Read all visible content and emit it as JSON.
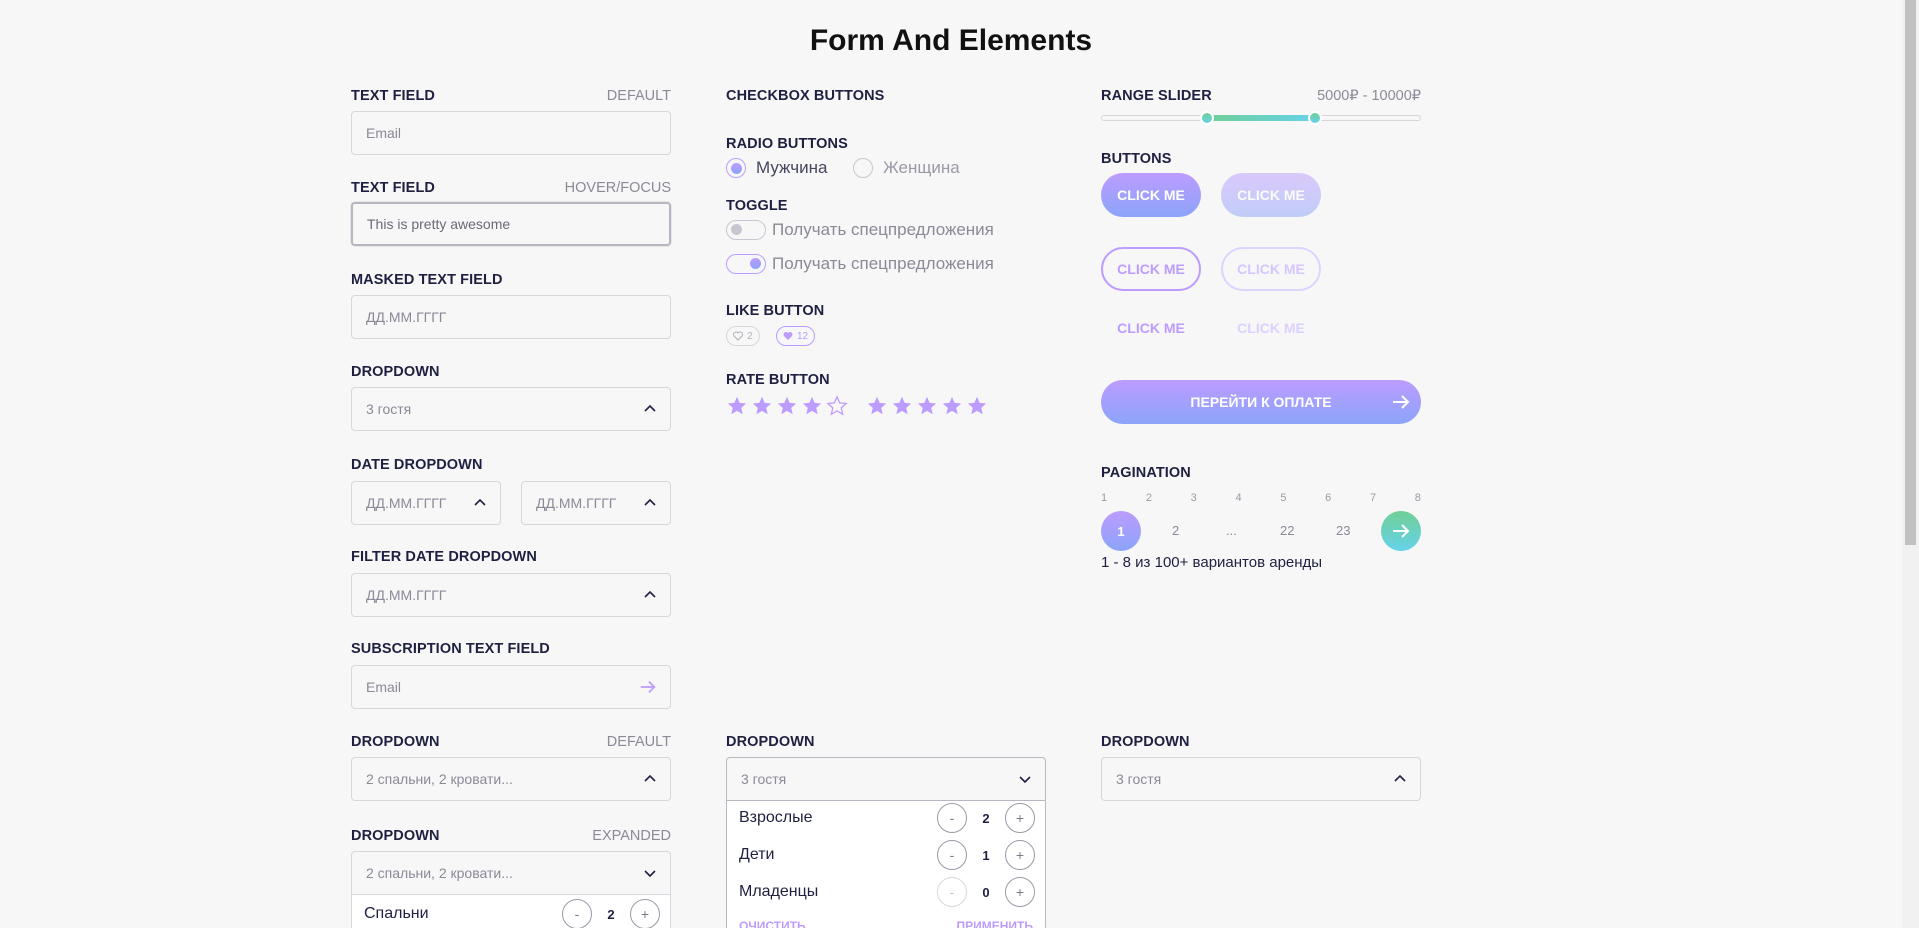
{
  "page_title": "Form And Elements",
  "col1": {
    "text_field": {
      "label": "TEXT FIELD",
      "state": "DEFAULT",
      "placeholder": "Email"
    },
    "text_field_focus": {
      "label": "TEXT FIELD",
      "state": "HOVER/FOCUS",
      "value": "This is pretty awesome"
    },
    "masked": {
      "label": "MASKED TEXT FIELD",
      "placeholder": "ДД.ММ.ГГГГ"
    },
    "dropdown": {
      "label": "DROPDOWN",
      "value": "3 гостя"
    },
    "date_dropdown": {
      "label": "DATE DROPDOWN",
      "from": "ДД.ММ.ГГГГ",
      "to": "ДД.ММ.ГГГГ"
    },
    "filter_date": {
      "label": "FILTER DATE DROPDOWN",
      "placeholder": "ДД.ММ.ГГГГ"
    },
    "subscription": {
      "label": "SUBSCRIPTION TEXT FIELD",
      "placeholder": "Email"
    },
    "dropdown_default": {
      "label": "DROPDOWN",
      "state": "DEFAULT",
      "value": "2  спальни, 2  кровати..."
    },
    "dropdown_expanded": {
      "label": "DROPDOWN",
      "state": "EXPANDED",
      "value": "2  спальни, 2  кровати...",
      "rows": [
        {
          "name": "Спальни",
          "count": "2"
        }
      ]
    }
  },
  "col2": {
    "checkbox_label": "CHECKBOX BUTTONS",
    "radio": {
      "label": "RADIO BUTTONS",
      "options": [
        "Мужчина",
        "Женщина"
      ],
      "selected": 0
    },
    "toggle": {
      "label": "TOGGLE",
      "items": [
        "Получать спецпредложения",
        "Получать спецпредложения"
      ]
    },
    "like": {
      "label": "LIKE BUTTON",
      "off_count": "2",
      "on_count": "12"
    },
    "rate": {
      "label": "RATE BUTTON",
      "first": 4,
      "second": 5
    },
    "guests_dropdown": {
      "label": "DROPDOWN",
      "value": "3 гостя",
      "rows": [
        {
          "name": "Взрослые",
          "count": "2"
        },
        {
          "name": "Дети",
          "count": "1"
        },
        {
          "name": "Младенцы",
          "count": "0"
        }
      ],
      "clear": "ОЧИСТИТЬ",
      "apply": "ПРИМЕНИТЬ"
    }
  },
  "col3": {
    "range": {
      "label": "RANGE SLIDER",
      "value_text": "5000₽ - 10000₽",
      "min_fraction": 0.33,
      "max_fraction": 0.67
    },
    "buttons": {
      "label": "BUTTONS",
      "click": "CLICK ME",
      "pay": "ПЕРЕЙТИ К ОПЛАТЕ"
    },
    "pagination": {
      "label": "PAGINATION",
      "numbers": [
        "1",
        "2",
        "3",
        "4",
        "5",
        "6",
        "7",
        "8"
      ],
      "current": "1",
      "items": [
        "2",
        "...",
        "22",
        "23"
      ],
      "info": "1 - 8 из 100+ вариантов аренды"
    },
    "dropdown": {
      "label": "DROPDOWN",
      "value": "3 гостя"
    }
  },
  "colors": {
    "purple": "#bc9cff",
    "blue": "#8ba4f9",
    "green": "#6fcf97",
    "text": "#1f2041"
  },
  "icons": [
    "chevron-up-icon",
    "chevron-down-icon",
    "arrow-right-icon",
    "heart-icon",
    "star-icon"
  ]
}
